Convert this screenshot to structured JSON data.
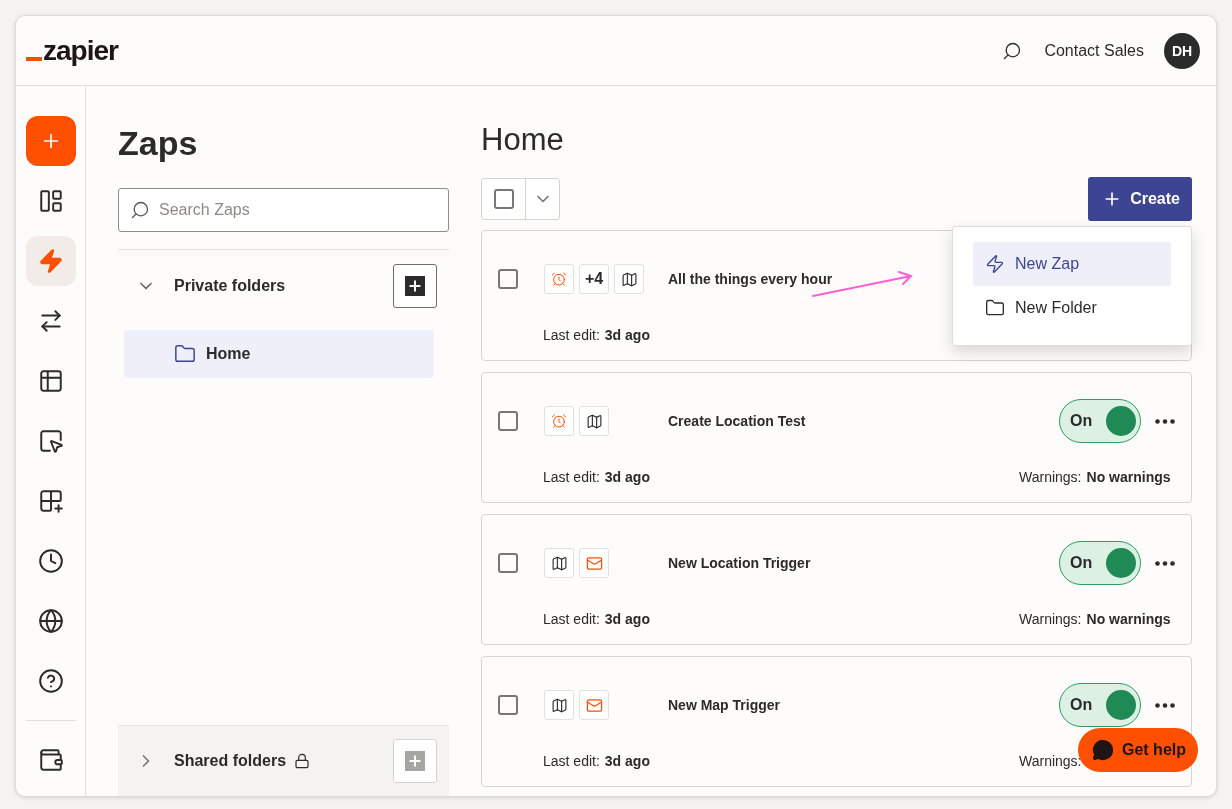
{
  "header": {
    "logo": "zapier",
    "contact": "Contact Sales",
    "avatar": "DH"
  },
  "rail": [
    {
      "kind": "create",
      "selected": false
    },
    {
      "kind": "dashboard",
      "selected": false
    },
    {
      "kind": "zaps",
      "selected": true
    },
    {
      "kind": "transfer",
      "selected": false
    },
    {
      "kind": "tables",
      "selected": false
    },
    {
      "kind": "interfaces",
      "selected": false
    },
    {
      "kind": "apps",
      "selected": false
    },
    {
      "kind": "history",
      "selected": false
    },
    {
      "kind": "globe",
      "selected": false
    },
    {
      "kind": "help",
      "selected": false
    },
    {
      "kind": "wallet",
      "selected": false
    }
  ],
  "folders": {
    "title": "Zaps",
    "search": {
      "placeholder": "Search Zaps"
    },
    "private": {
      "label": "Private folders",
      "expanded": true,
      "items": [
        {
          "label": "Home",
          "selected": true
        }
      ]
    },
    "shared": {
      "label": "Shared folders",
      "expanded": false,
      "locked": true,
      "disabled": true
    }
  },
  "main": {
    "title": "Home",
    "bulk_select": {
      "checked": false
    },
    "create": "Create",
    "menu": [
      {
        "label": "New Zap",
        "kind": "zap",
        "selected": true
      },
      {
        "label": "New Folder",
        "kind": "folder",
        "selected": false
      }
    ],
    "zaps": [
      {
        "name": "All the things every hour",
        "apps": [
          {
            "kind": "alarm"
          },
          {
            "kind": "count",
            "text": "+4"
          },
          {
            "kind": "map"
          }
        ],
        "edit_label": "Last edit:",
        "edit_value": "3d ago",
        "checked": false
      },
      {
        "name": "Create Location Test",
        "apps": [
          {
            "kind": "alarm"
          },
          {
            "kind": "map"
          }
        ],
        "edit_label": "Last edit:",
        "edit_value": "3d ago",
        "checked": false,
        "toggle": {
          "label": "On",
          "on": true
        },
        "warnings_label": "Warnings:",
        "warnings_value": "No warnings"
      },
      {
        "name": "New Location Trigger",
        "apps": [
          {
            "kind": "map"
          },
          {
            "kind": "mail"
          }
        ],
        "edit_label": "Last edit:",
        "edit_value": "3d ago",
        "checked": false,
        "toggle": {
          "label": "On",
          "on": true
        },
        "warnings_label": "Warnings:",
        "warnings_value": "No warnings"
      },
      {
        "name": "New Map Trigger",
        "apps": [
          {
            "kind": "map"
          },
          {
            "kind": "mail"
          }
        ],
        "edit_label": "Last edit:",
        "edit_value": "3d ago",
        "checked": false,
        "toggle": {
          "label": "On",
          "on": true
        },
        "warnings_label": "Warnings:"
      }
    ]
  },
  "help": {
    "label": "Get help"
  }
}
